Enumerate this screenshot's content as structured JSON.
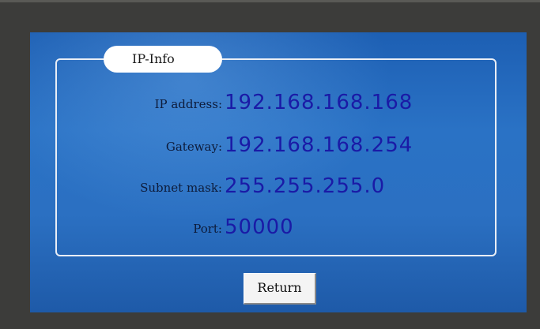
{
  "group": {
    "title": "IP-Info"
  },
  "fields": {
    "ip_address": {
      "label": "IP address:",
      "value": "192.168.168.168"
    },
    "gateway": {
      "label": "Gateway:",
      "value": "192.168.168.254"
    },
    "subnet_mask": {
      "label": "Subnet mask:",
      "value": "255.255.255.0"
    },
    "port": {
      "label": "Port:",
      "value": "50000"
    }
  },
  "actions": {
    "return_label": "Return"
  },
  "colors": {
    "screen_background": "#2a72c5",
    "value_text": "#1a1aa6",
    "label_text": "#0d1b3a",
    "frame": "#3c3c3a"
  }
}
